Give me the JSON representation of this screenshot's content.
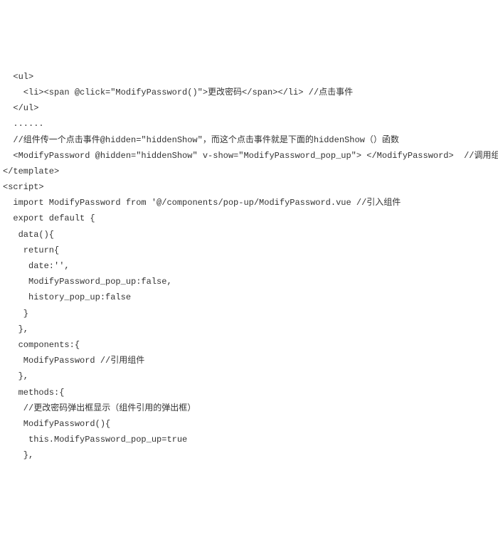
{
  "code": {
    "lines": [
      "  <ul>",
      "    <li><span @click=\"ModifyPassword()\">更改密码</span></li> //点击事件",
      "  </ul>",
      "  ......",
      "  //组件传一个点击事件@hidden=\"hiddenShow\"，而这个点击事件就是下面的hiddenShow（）函数",
      "  <ModifyPassword @hidden=\"hiddenShow\" v-show=\"ModifyPassword_pop_up\"> </ModifyPassword>  //调用组件",
      "</template>",
      "<script>",
      "  import ModifyPassword from '@/components/pop-up/ModifyPassword.vue //引入组件",
      "  export default {",
      "   data(){",
      "    return{",
      "     date:'',",
      "     ModifyPassword_pop_up:false,",
      "     history_pop_up:false",
      "    }",
      "   },",
      "   components:{",
      "    ModifyPassword //引用组件",
      "   },",
      "   methods:{",
      "    //更改密码弹出框显示（组件引用的弹出框）",
      "    ModifyPassword(){",
      "     this.ModifyPassword_pop_up=true",
      "    },"
    ]
  }
}
